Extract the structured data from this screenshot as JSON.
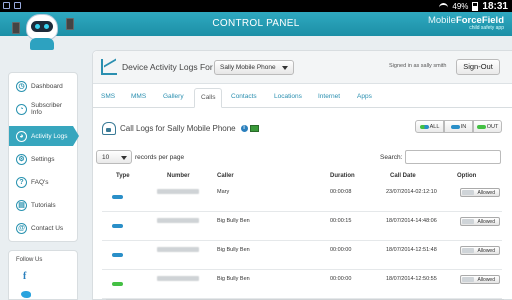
{
  "statusbar": {
    "battery": "49%",
    "time": "18:31"
  },
  "header": {
    "title": "CONTROL PANEL",
    "brand_light": "Mobile",
    "brand_bold": "ForceField",
    "tagline": "child safety app"
  },
  "sidebar": {
    "items": [
      {
        "label": "Dashboard",
        "icon": "dashboard-icon",
        "glyph": "◷"
      },
      {
        "label": "Subscriber Info",
        "icon": "subscriber-icon",
        "glyph": "◔"
      },
      {
        "label": "Activity Logs",
        "icon": "activity-logs-icon",
        "glyph": "◕"
      },
      {
        "label": "Settings",
        "icon": "gear-icon",
        "glyph": "⚙"
      },
      {
        "label": "FAQ's",
        "icon": "question-icon",
        "glyph": "?"
      },
      {
        "label": "Tutorials",
        "icon": "tutorials-icon",
        "glyph": "▤"
      },
      {
        "label": "Contact Us",
        "icon": "at-icon",
        "glyph": "@"
      }
    ],
    "active_index": 2,
    "follow_label": "Follow Us",
    "facebook": "f"
  },
  "topbar": {
    "label": "Device Activity Logs For",
    "device": "Sally Mobile Phone",
    "signed_in": "Signed in as sally smith",
    "signout": "Sign-Out"
  },
  "tabs": [
    "SMS",
    "MMS",
    "Gallery",
    "Calls",
    "Contacts",
    "Locations",
    "Internet",
    "Apps"
  ],
  "active_tab": "Calls",
  "call_logs_title": "Call Logs for Sally Mobile Phone",
  "filters": {
    "all": "ALL",
    "in": "IN",
    "out": "OUT"
  },
  "records": {
    "value": "10",
    "label": "records per page"
  },
  "search": {
    "label": "Search:",
    "value": ""
  },
  "table": {
    "headers": {
      "type": "Type",
      "number": "Number",
      "caller": "Caller",
      "duration": "Duration",
      "date": "Call Date",
      "option": "Option"
    },
    "rows": [
      {
        "type": "in",
        "caller": "Mary",
        "duration": "00:00:08",
        "date": "23/07/2014-02:12:10",
        "option": "Allowed"
      },
      {
        "type": "in",
        "caller": "Big Bully Ben",
        "duration": "00:00:15",
        "date": "18/07/2014-14:48:06",
        "option": "Allowed"
      },
      {
        "type": "in",
        "caller": "Big Bully Ben",
        "duration": "00:00:00",
        "date": "18/07/2014-12:51:48",
        "option": "Allowed"
      },
      {
        "type": "out",
        "caller": "Big Bully Ben",
        "duration": "00:00:00",
        "date": "18/07/2014-12:50:55",
        "option": "Allowed"
      }
    ]
  },
  "colors": {
    "accent": "#37a6be",
    "header": "#1c8fa6",
    "incoming": "#2a8fc8",
    "outgoing": "#44c044"
  }
}
